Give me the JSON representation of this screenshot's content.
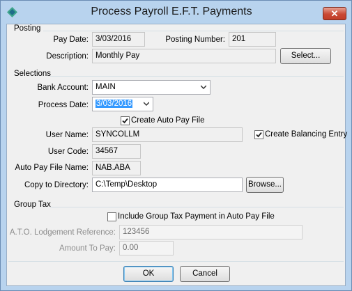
{
  "window": {
    "title": "Process Payroll E.F.T. Payments",
    "close_label": "✕"
  },
  "posting": {
    "group_label": "Posting",
    "pay_date_label": "Pay Date:",
    "pay_date": "3/03/2016",
    "posting_number_label": "Posting Number:",
    "posting_number": "201",
    "description_label": "Description:",
    "description": "Monthly Pay",
    "select_button": "Select..."
  },
  "selections": {
    "group_label": "Selections",
    "bank_account_label": "Bank Account:",
    "bank_account": "MAIN",
    "process_date_label": "Process Date:",
    "process_date": "3/03/2016",
    "create_auto_pay_label": "Create Auto Pay File",
    "create_auto_pay_checked": true,
    "user_name_label": "User Name:",
    "user_name": "SYNCOLLM",
    "create_balancing_label": "Create Balancing Entry",
    "create_balancing_checked": true,
    "user_code_label": "User Code:",
    "user_code": "34567",
    "auto_pay_file_label": "Auto Pay File Name:",
    "auto_pay_file": "NAB.ABA",
    "copy_dir_label": "Copy to Directory:",
    "copy_dir": "C:\\Temp\\Desktop",
    "browse_button": "Browse..."
  },
  "group_tax": {
    "group_label": "Group Tax",
    "include_label": "Include Group Tax Payment in Auto Pay File",
    "include_checked": false,
    "ato_ref_label": "A.T.O. Lodgement Reference:",
    "ato_ref": "123456",
    "amount_label": "Amount To Pay:",
    "amount": "0.00"
  },
  "footer": {
    "ok_button": "OK",
    "cancel_button": "Cancel"
  }
}
